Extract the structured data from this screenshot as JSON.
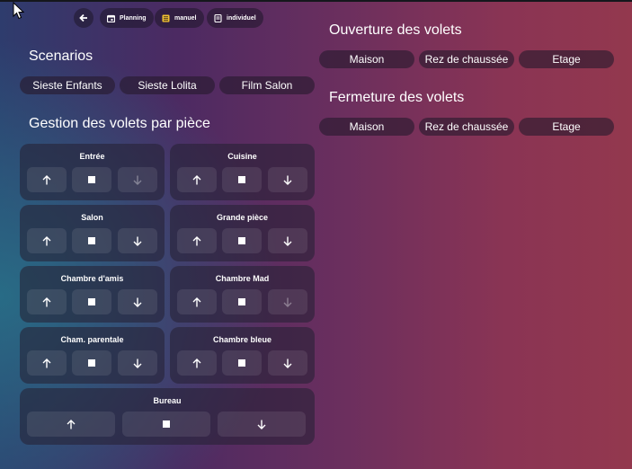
{
  "header": {
    "chips": [
      {
        "label": "Planning",
        "icon": "calendar-icon"
      },
      {
        "label": "manuel",
        "icon": "list-icon"
      },
      {
        "label": "individuel",
        "icon": "card-icon"
      }
    ]
  },
  "scenarios": {
    "title": "Scenarios",
    "buttons": [
      "Sieste Enfants",
      "Sieste Lolita",
      "Film Salon"
    ]
  },
  "rooms": {
    "title": "Gestion des volets par pièce",
    "cards": [
      {
        "name": "Entrée",
        "down_disabled": true
      },
      {
        "name": "Cuisine"
      },
      {
        "name": "Salon"
      },
      {
        "name": "Grande pièce"
      },
      {
        "name": "Chambre d'amis"
      },
      {
        "name": "Chambre Mad",
        "down_disabled": true
      },
      {
        "name": "Cham. parentale"
      },
      {
        "name": "Chambre bleue"
      },
      {
        "name": "Bureau"
      }
    ]
  },
  "ouverture": {
    "title": "Ouverture des volets",
    "buttons": [
      "Maison",
      "Rez de chaussée",
      "Etage"
    ]
  },
  "fermeture": {
    "title": "Fermeture des volets",
    "buttons": [
      "Maison",
      "Rez de chaussée",
      "Etage"
    ]
  }
}
